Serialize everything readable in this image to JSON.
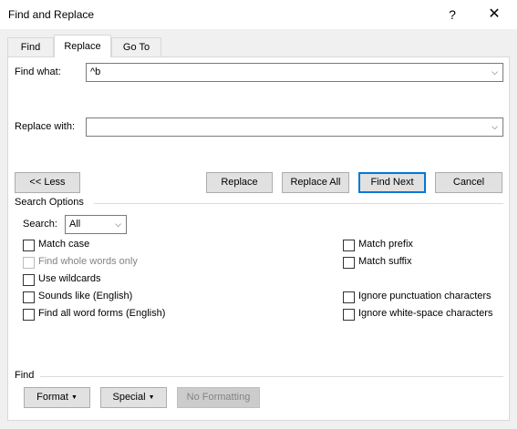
{
  "window": {
    "title": "Find and Replace",
    "help_icon": "?",
    "close_icon": "✕"
  },
  "tabs": [
    {
      "label": "Find",
      "active": false
    },
    {
      "label": "Replace",
      "active": true
    },
    {
      "label": "Go To",
      "active": false
    }
  ],
  "find": {
    "label": "Find what:",
    "value": "^b"
  },
  "replace": {
    "label": "Replace with:",
    "value": ""
  },
  "buttons": {
    "less": "<< Less",
    "replace": "Replace",
    "replace_all": "Replace All",
    "find_next": "Find Next",
    "cancel": "Cancel"
  },
  "search_options": {
    "title": "Search Options",
    "search_label": "Search:",
    "search_value": "All",
    "left": [
      {
        "label": "Match case",
        "checked": false,
        "enabled": true
      },
      {
        "label": "Find whole words only",
        "checked": false,
        "enabled": false
      },
      {
        "label": "Use wildcards",
        "checked": false,
        "enabled": true
      },
      {
        "label": "Sounds like (English)",
        "checked": false,
        "enabled": true
      },
      {
        "label": "Find all word forms (English)",
        "checked": false,
        "enabled": true
      }
    ],
    "right": [
      {
        "label": "Match prefix",
        "checked": false,
        "enabled": true
      },
      {
        "label": "Match suffix",
        "checked": false,
        "enabled": true
      },
      {
        "label": "Ignore punctuation characters",
        "checked": false,
        "enabled": true
      },
      {
        "label": "Ignore white-space characters",
        "checked": false,
        "enabled": true
      }
    ]
  },
  "find_section": {
    "title": "Find",
    "format": "Format",
    "special": "Special",
    "no_formatting": "No Formatting"
  }
}
